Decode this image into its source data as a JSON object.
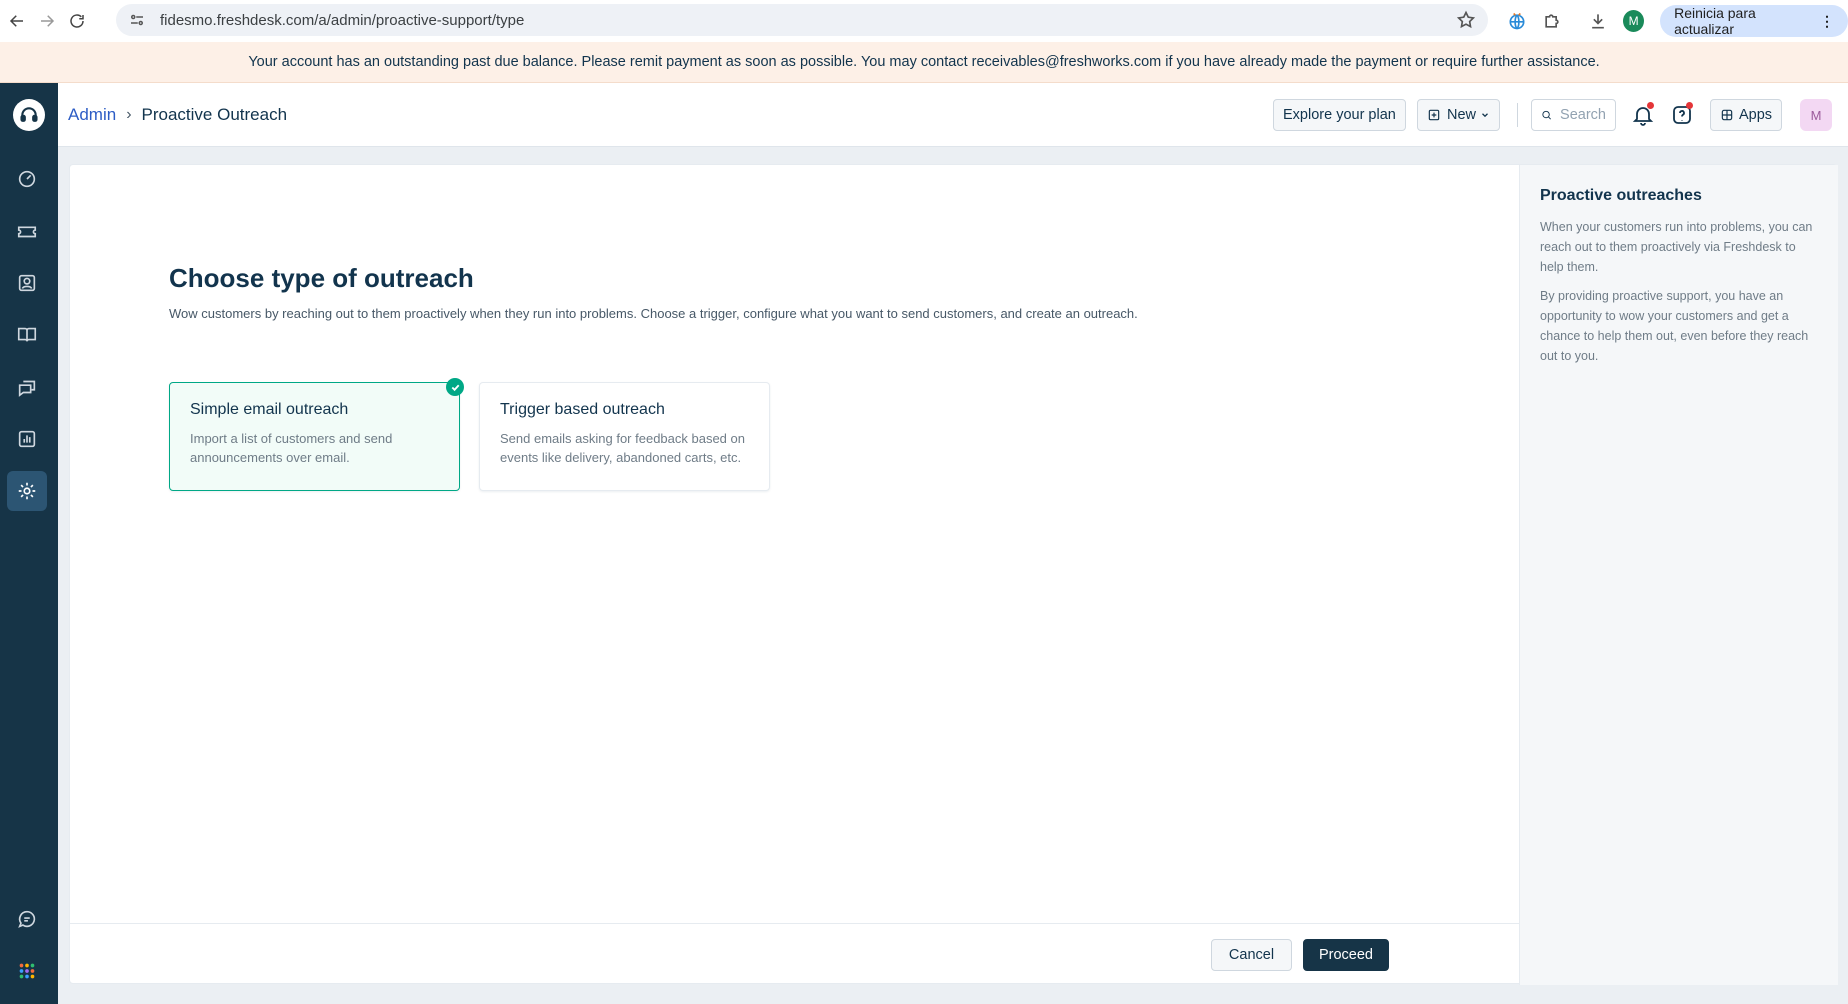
{
  "browser": {
    "url": "fidesmo.freshdesk.com/a/admin/proactive-support/type",
    "profile_initial": "M",
    "update_label": "Reinicia para actualizar"
  },
  "banner": {
    "text": "Your account has an outstanding past due balance. Please remit payment as soon as possible. You may contact receivables@freshworks.com if you have already made the payment or require further assistance."
  },
  "breadcrumb": {
    "parent": "Admin",
    "current": "Proactive Outreach"
  },
  "header": {
    "explore_label": "Explore your plan",
    "new_label": "New",
    "search_placeholder": "Search",
    "apps_label": "Apps",
    "avatar_initial": "M"
  },
  "main": {
    "title": "Choose type of outreach",
    "description": "Wow customers by reaching out to them proactively when they run into problems. Choose a trigger, configure what you want to send customers, and create an outreach.",
    "options": [
      {
        "title": "Simple email outreach",
        "description": "Import a list of customers and send announcements over email.",
        "selected": true
      },
      {
        "title": "Trigger based outreach",
        "description": "Send emails asking for feedback based on events like delivery, abandoned carts, etc.",
        "selected": false
      }
    ],
    "cancel_label": "Cancel",
    "proceed_label": "Proceed"
  },
  "side_panel": {
    "title": "Proactive outreaches",
    "paragraphs": [
      "When your customers run into problems, you can reach out to them proactively via Freshdesk to help them.",
      "By providing proactive support, you have an opportunity to wow your customers and get a chance to help them out, even before they reach out to you."
    ]
  },
  "colors": {
    "nav_bg": "#163447",
    "accent_green": "#00a886",
    "link_blue": "#2c5cc5",
    "banner_bg": "#fdf0e7"
  }
}
